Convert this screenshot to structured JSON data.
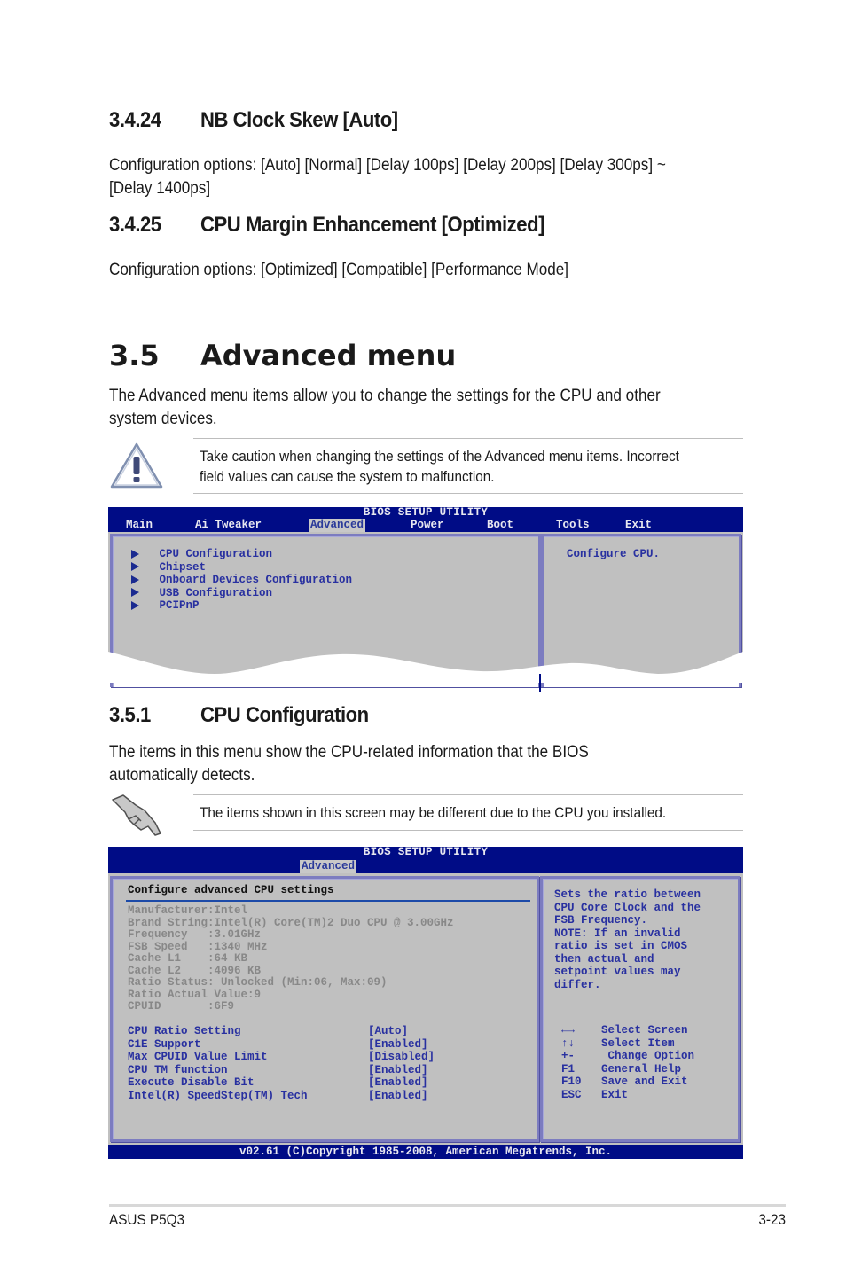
{
  "sections": {
    "s3424": {
      "number": "3.4.24",
      "title": "NB Clock Skew [Auto]",
      "body_line1": "Configuration options: [Auto] [Normal] [Delay 100ps] [Delay 200ps] [Delay 300ps] ~",
      "body_line2": "[Delay 1400ps]"
    },
    "s3425": {
      "number": "3.4.25",
      "title": "CPU Margin Enhancement [Optimized]",
      "body": "Configuration options: [Optimized] [Compatible] [Performance Mode]"
    },
    "s35": {
      "number": "3.5",
      "title": "Advanced menu",
      "body_line1": "The Advanced menu items allow you to change the settings for the CPU and other",
      "body_line2": "system devices."
    },
    "caution": {
      "icon": "warning-icon",
      "line1": "Take caution when changing the settings of the Advanced menu items. Incorrect",
      "line2": "field values can cause the system to malfunction."
    },
    "s351": {
      "number": "3.5.1",
      "title": "CPU Configuration",
      "body_line1": "The items in this menu show the CPU-related information that the BIOS",
      "body_line2": "automatically detects."
    },
    "note": {
      "icon": "pointing-hand-icon",
      "text": "The items shown in this screen may be different due to the CPU you installed."
    }
  },
  "bios1": {
    "title": "BIOS SETUP UTILITY",
    "menu": [
      "Main",
      "Ai Tweaker",
      "Advanced",
      "Power",
      "Boot",
      "Tools",
      "Exit"
    ],
    "active_menu": "Advanced",
    "items": [
      "CPU Configuration",
      "Chipset",
      "Onboard Devices Configuration",
      "USB Configuration",
      "PCIPnP"
    ],
    "help": "Configure CPU."
  },
  "bios2": {
    "title": "BIOS SETUP UTILITY",
    "active_menu": "Advanced",
    "section_header": "Configure advanced CPU settings",
    "info": [
      "Manufacturer:Intel",
      "Brand String:Intel(R) Core(TM)2 Duo CPU @ 3.00GHz",
      "Frequency   :3.01GHz",
      "FSB Speed   :1340 MHz",
      "Cache L1    :64 KB",
      "Cache L2    :4096 KB",
      "Ratio Status: Unlocked (Min:06, Max:09)",
      "Ratio Actual Value:9",
      "CPUID       :6F9"
    ],
    "settings": [
      {
        "label": "CPU Ratio Setting",
        "value": "[Auto]"
      },
      {
        "label": "C1E Support",
        "value": "[Enabled]"
      },
      {
        "label": "Max CPUID Value Limit",
        "value": "[Disabled]"
      },
      {
        "label": "CPU TM function",
        "value": "[Enabled]"
      },
      {
        "label": "Execute Disable Bit",
        "value": "[Enabled]"
      },
      {
        "label": "Intel(R) SpeedStep(TM) Tech",
        "value": "[Enabled]"
      }
    ],
    "help": [
      "Sets the ratio between",
      "CPU Core Clock and the",
      "FSB Frequency.",
      "NOTE: If an invalid",
      "ratio is set in CMOS",
      "then actual and",
      "setpoint values may",
      "differ."
    ],
    "keys": [
      {
        "key": "←→",
        "action": "Select Screen"
      },
      {
        "key": "↑↓",
        "action": "Select Item"
      },
      {
        "key": "+-",
        "action": " Change Option"
      },
      {
        "key": "F1",
        "action": "General Help"
      },
      {
        "key": "F10",
        "action": "Save and Exit"
      },
      {
        "key": "ESC",
        "action": "Exit"
      }
    ],
    "footer": "v02.61 (C)Copyright 1985-2008, American Megatrends, Inc."
  },
  "footer": {
    "left": "ASUS P5Q3",
    "right": "3-23"
  }
}
